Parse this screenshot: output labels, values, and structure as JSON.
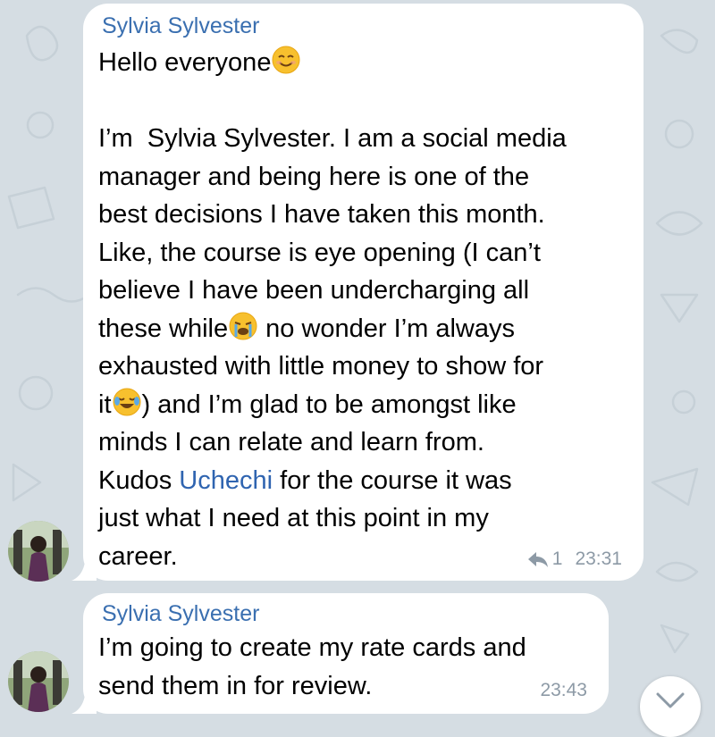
{
  "chat": {
    "background_color": "#d5dde3",
    "messages": [
      {
        "sender": "Sylvia Sylvester",
        "lines": {
          "l1": "Hello everyone",
          "l3": "I’m  Sylvia Sylvester. I am a social media",
          "l4": "manager and being here is one of the",
          "l5": "best decisions I have taken this month.",
          "l6": "Like, the course is eye opening (I can’t",
          "l7": "believe I have been undercharging all",
          "l8a": "these while",
          "l8b": " no wonder I’m always",
          "l9": "exhausted with little money to show for",
          "l10a": "it",
          "l10b": ") and I’m glad to be amongst like",
          "l11": "minds I can relate and learn from.",
          "l12a": "Kudos ",
          "l12_mention": "Uchechi",
          "l12b": " for the course it was",
          "l13": "just what I need at this point in my",
          "l14": "career."
        },
        "emojis": [
          "smiling-face-emoji",
          "loudly-crying-face-emoji",
          "face-with-tears-of-joy-emoji"
        ],
        "reply_count": "1",
        "time": "23:31"
      },
      {
        "sender": "Sylvia Sylvester",
        "lines": {
          "l1": "I’m going to create my rate cards and",
          "l2": "send them in for review."
        },
        "time": "23:43"
      }
    ],
    "icons": [
      "reply-arrow-icon",
      "chevron-down-icon",
      "avatar"
    ]
  }
}
